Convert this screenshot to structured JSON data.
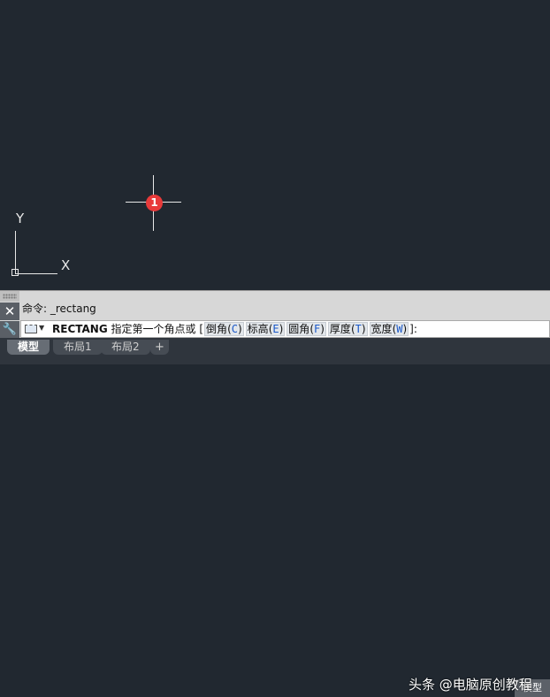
{
  "canvas": {
    "ucs": {
      "y_label": "Y",
      "x_label": "X"
    },
    "marker": {
      "number": "1",
      "color": "#e83a3a"
    },
    "background_color": "#212830"
  },
  "command_panel": {
    "close_icon": "close-icon",
    "settings_icon": "wrench-icon",
    "history_line": "命令: _rectang",
    "input": {
      "command": "RECTANG",
      "prompt": "指定第一个角点或",
      "open_bracket": "[",
      "options": [
        {
          "label": "倒角",
          "key": "C"
        },
        {
          "label": "标高",
          "key": "E"
        },
        {
          "label": "圆角",
          "key": "F"
        },
        {
          "label": "厚度",
          "key": "T"
        },
        {
          "label": "宽度",
          "key": "W"
        }
      ],
      "close_suffix": "]:"
    }
  },
  "tabs": [
    {
      "label": "模型",
      "active": true
    },
    {
      "label": "布局1",
      "active": false
    },
    {
      "label": "布局2",
      "active": false
    }
  ],
  "add_tab": "+",
  "watermark": "头条 @电脑原创教程",
  "corner_button": "模型"
}
